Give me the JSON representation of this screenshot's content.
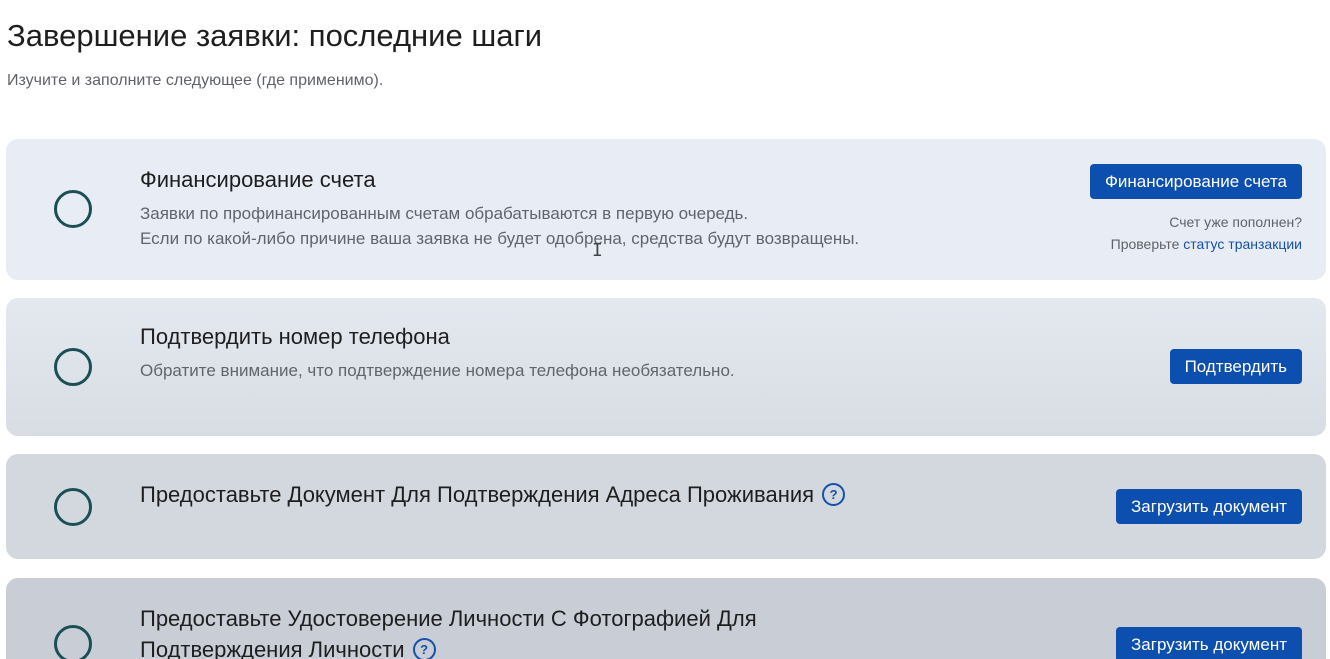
{
  "header": {
    "title": "Завершение заявки: последние шаги",
    "subtitle": "Изучите и заполните следующее (где применимо)."
  },
  "steps": [
    {
      "title": "Финансирование счета",
      "description_lines": [
        "Заявки по профинансированным счетам обрабатываются в первую очередь.",
        "Если по какой-либо причине ваша заявка не будет одобрена, средства будут возвращены."
      ],
      "button_label": "Финансирование счета",
      "note_line1": "Счет уже пополнен?",
      "note_line2_prefix": "Проверьте ",
      "note_link": "статус транзакции",
      "status_icon": "empty-circle-icon"
    },
    {
      "title": "Подтвердить номер телефона",
      "description_lines": [
        "Обратите внимание, что подтверждение номера телефона необязательно."
      ],
      "button_label": "Подтвердить",
      "status_icon": "empty-circle-icon"
    },
    {
      "title": "Предоставьте Документ Для Подтверждения Адреса Проживания",
      "button_label": "Загрузить документ",
      "status_icon": "empty-circle-icon",
      "help_icon": "question-circle-icon",
      "help_glyph": "?"
    },
    {
      "title_line1": "Предоставьте Удостоверение Личности С Фотографией Для",
      "title_line2": "Подтверждения Личности",
      "button_label": "Загрузить документ",
      "status_icon": "empty-circle-icon",
      "help_icon": "question-circle-icon",
      "help_glyph": "?"
    }
  ],
  "colors": {
    "accent": "#0d4fae",
    "link": "#1650a8",
    "circle": "#1c4f55"
  }
}
